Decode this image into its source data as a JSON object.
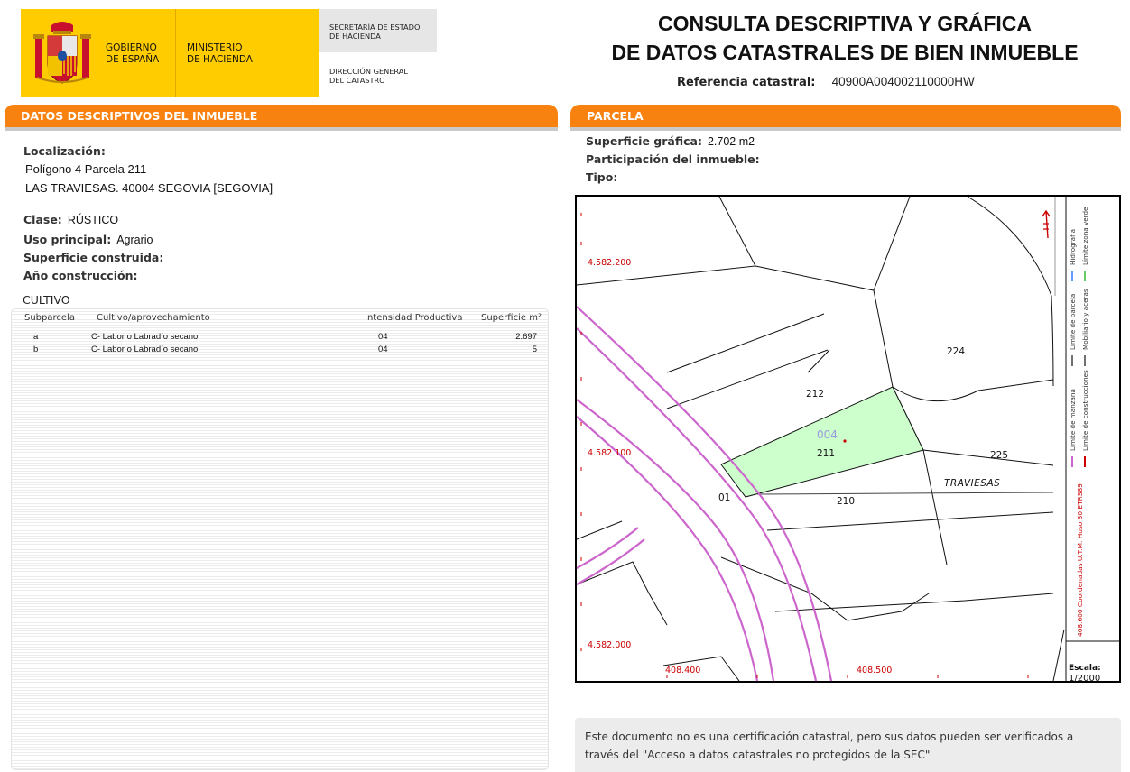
{
  "header": {
    "gob_line1": "GOBIERNO",
    "gob_line2": "DE ESPAÑA",
    "min_line1": "MINISTERIO",
    "min_line2": "DE HACIENDA",
    "sec_line1": "SECRETARÍA DE ESTADO",
    "sec_line2": "DE HACIENDA",
    "dg_line1": "DIRECCIÓN GENERAL",
    "dg_line2": "DEL CATASTRO",
    "title_line1": "CONSULTA DESCRIPTIVA Y GRÁFICA",
    "title_line2": "DE DATOS CATASTRALES DE BIEN INMUEBLE",
    "ref_label": "Referencia catastral:",
    "ref_value": "40900A004002110000HW"
  },
  "colors": {
    "accent": "#f7820f",
    "logo_yellow": "#ffcc00",
    "parcel_fill": "#ccffcc",
    "road": "#cc66cc",
    "coords": "#cc0000"
  },
  "descriptive": {
    "section_title": "DATOS DESCRIPTIVOS DEL INMUEBLE",
    "loc_label": "Localización:",
    "loc_line1": "Polígono 4 Parcela 211",
    "loc_line2": "LAS TRAVIESAS. 40004 SEGOVIA [SEGOVIA]",
    "clase_label": "Clase:",
    "clase_value": "RÚSTICO",
    "uso_label": "Uso principal:",
    "uso_value": "Agrario",
    "sup_label": "Superficie construida:",
    "anio_label": "Año construcción:",
    "cultivo_title": "CULTIVO",
    "table": {
      "headers": [
        "Subparcela",
        "Cultivo/aprovechamiento",
        "Intensidad Productiva",
        "Superficie m²"
      ],
      "rows": [
        [
          "a",
          "C- Labor o Labradío secano",
          "04",
          "2.697"
        ],
        [
          "b",
          "C- Labor o Labradío secano",
          "04",
          "5"
        ]
      ]
    }
  },
  "parcela": {
    "section_title": "PARCELA",
    "sup_label": "Superficie gráfica:",
    "sup_value": "2.702 m2",
    "part_label": "Participación del inmueble:",
    "tipo_label": "Tipo:"
  },
  "map": {
    "coords": [
      "4.582.200",
      "4.582.100",
      "4.582.000",
      "408.400",
      "408.500"
    ],
    "parcels": [
      "224",
      "212",
      "004",
      "211",
      "225",
      "TRAVIESAS",
      "01",
      "210"
    ],
    "legend": {
      "manzana": "Límite de manzana",
      "parcela": "Límite de parcela",
      "hidro": "Hidrografía",
      "construcciones": "Límite de construcciones",
      "mobiliario": "Mobiliario y aceras",
      "zona_verde": "Límite zona verde",
      "utm": "408.600 Coordenadas U.T.M. Huso 30 ETRS89",
      "escala_label": "Escala:",
      "escala_value": "1/2000"
    }
  },
  "notice": {
    "text": "Este documento no es una certificación catastral, pero sus datos pueden ser verificados a través del \"Acceso a datos catastrales no protegidos de la SEC\""
  }
}
